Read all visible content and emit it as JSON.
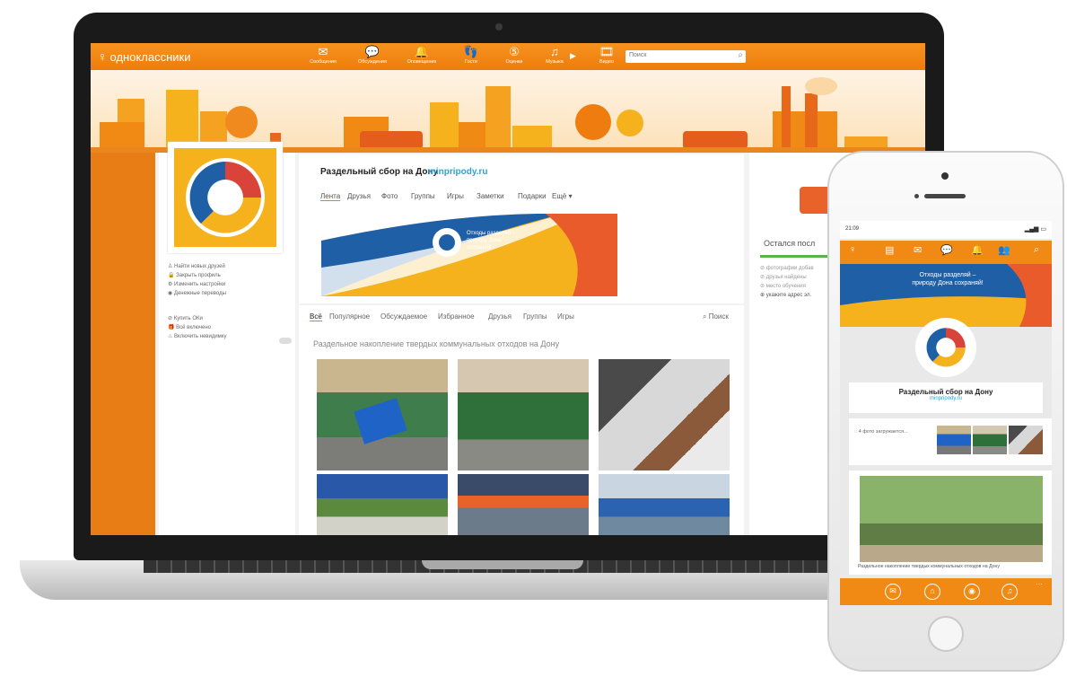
{
  "site": {
    "logo_text": "одноклассники",
    "nav": [
      {
        "label": "Сообщения",
        "icon": "envelope-icon"
      },
      {
        "label": "Обсуждения",
        "icon": "chat-icon"
      },
      {
        "label": "Оповещения",
        "icon": "bell-icon"
      },
      {
        "label": "Гости",
        "icon": "footprints-icon"
      },
      {
        "label": "Оценки",
        "icon": "rating-icon"
      },
      {
        "label": "Музыка",
        "icon": "music-icon"
      },
      {
        "label": "Видео",
        "icon": "video-icon"
      }
    ],
    "search_placeholder": "Поиск"
  },
  "left_menu": {
    "items_a": [
      "Найти новых друзей",
      "Закрыть профиль",
      "Изменить настройки",
      "Денежные переводы"
    ],
    "items_b": [
      "Купить ОКи",
      "Всё включено",
      "Включить невидимку"
    ]
  },
  "group": {
    "title": "Раздельный сбор на Дону",
    "url": "minpripody.ru",
    "tabs": [
      "Лента",
      "Друзья",
      "Фото",
      "Группы",
      "Игры",
      "Заметки",
      "Подарки",
      "Ещё ▾"
    ],
    "promo_text": "Отходы разделяй – природу Дона сохраняй!",
    "feed_tabs": [
      "Всё",
      "Популярное",
      "Обсуждаемое",
      "Избранное",
      "Друзья",
      "Группы",
      "Игры"
    ],
    "feed_search": "Поиск",
    "feed_title": "Раздельное накопление твердых коммунальных отходов на Дону"
  },
  "right_panel": {
    "heading": "Остался посл",
    "items": [
      "фотографии добав",
      "друзья найдены",
      "место обучения",
      "укажите адрес эл."
    ]
  },
  "phone": {
    "status_time": "21:09",
    "banner_text": "Отходы разделяй – природу Дона сохраняй!",
    "group_title": "Раздельный сбор на Дону",
    "group_url": "minpripody.ru",
    "photos_loading": "4 фото загружается...",
    "post_caption": "Раздельное накопление твердых коммунальных отходов на Дону",
    "bottom_icons": [
      "envelope-icon",
      "home-icon",
      "camera-icon",
      "music-icon"
    ]
  },
  "colors": {
    "accent": "#ee7c0e",
    "link": "#2aa4dd",
    "logo_blue": "#1f5fa6",
    "logo_yellow": "#f6b21c"
  }
}
